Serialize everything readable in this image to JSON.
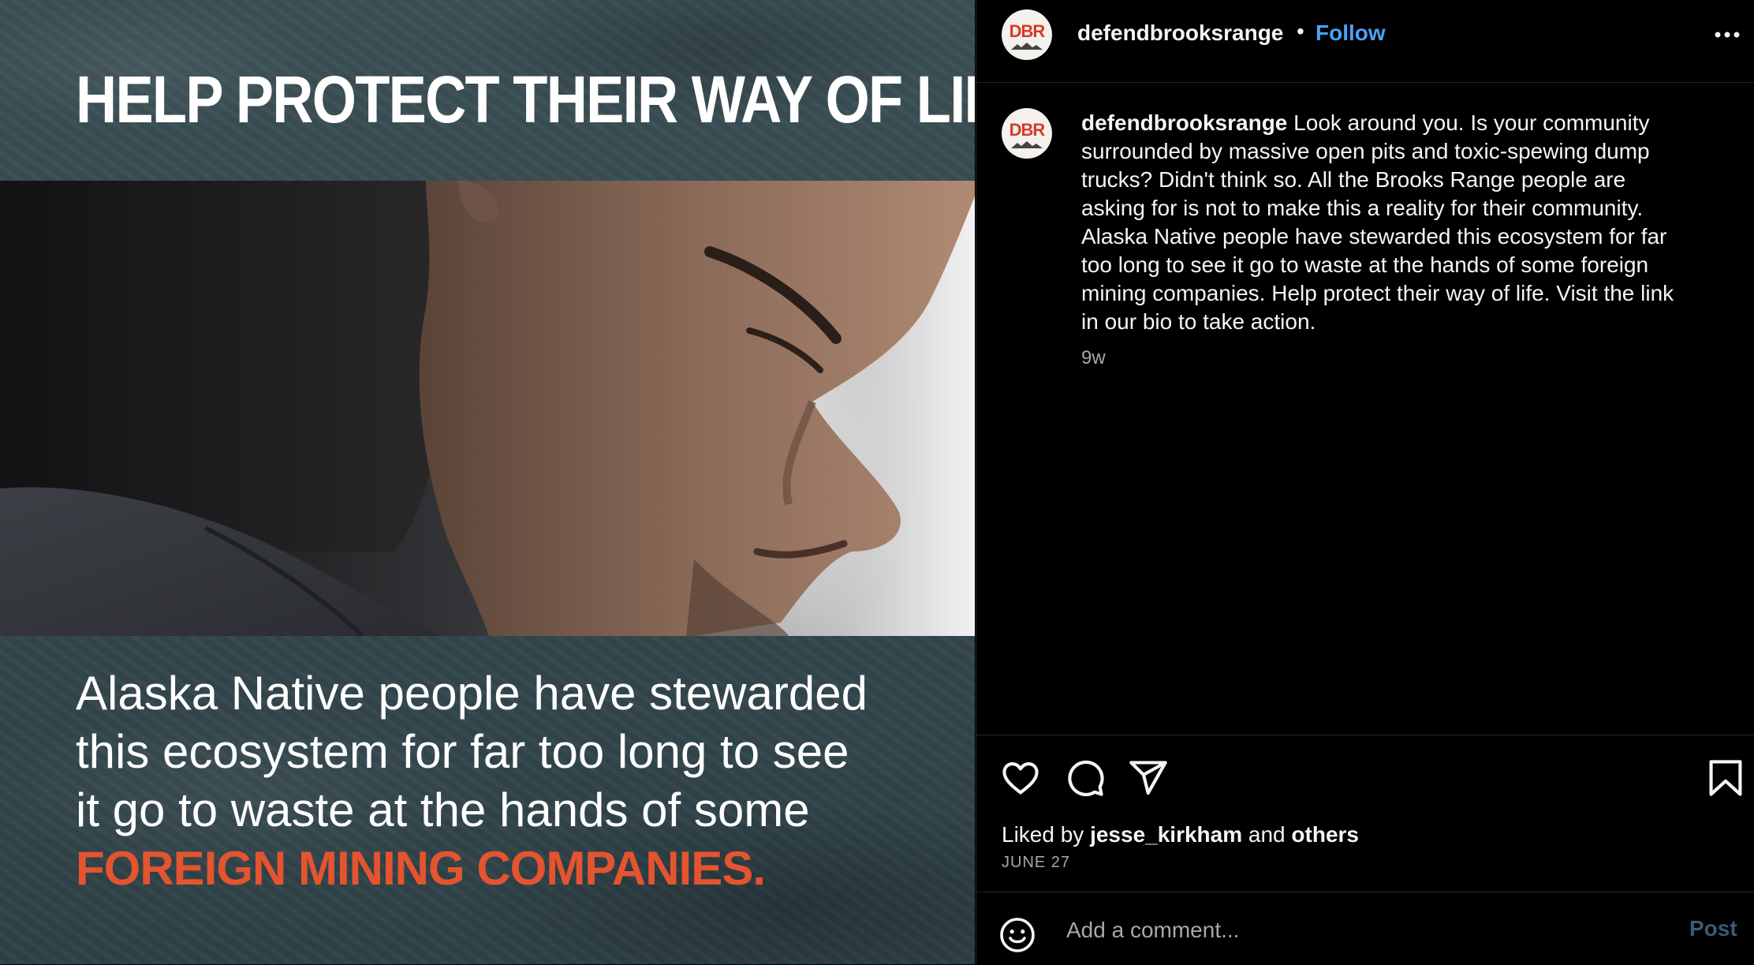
{
  "media": {
    "headline": "HELP PROTECT THEIR WAY OF LIFE",
    "body_lines": [
      "Alaska Native people have stewarded",
      "this ecosystem for far too long to see",
      "it go to waste at the hands of some"
    ],
    "accent_line": "FOREIGN MINING COMPANIES",
    "accent_punct": ".",
    "colors": {
      "background": "#34474d",
      "accent": "#e4542f"
    }
  },
  "header": {
    "avatar_text": "DBR",
    "username": "defendbrooksrange",
    "separator": "•",
    "follow_label": "Follow"
  },
  "caption": {
    "username": "defendbrooksrange",
    "first_line_rest": " Look around you. Is your community",
    "lines": [
      "surrounded by massive open pits and toxic-spewing dump",
      "trucks? Didn't think so. All the Brooks Range people are",
      "asking for is not to make this a reality for their community.",
      "Alaska Native people have stewarded this ecosystem for far",
      "too long to see it go to waste at the hands of some foreign",
      "mining companies. Help protect their way of life. Visit the link",
      "in our bio to take action."
    ],
    "age": "9w"
  },
  "actions": {
    "icons": [
      "heart-icon",
      "comment-icon",
      "share-icon",
      "bookmark-icon"
    ],
    "liked_by_prefix": "Liked by ",
    "liked_by_user": "jesse_kirkham",
    "liked_by_middle": " and ",
    "liked_by_others": "others",
    "date": "JUNE 27"
  },
  "comment_bar": {
    "placeholder": "Add a comment...",
    "post_label": "Post",
    "emoji_icon": "smiley-icon"
  }
}
